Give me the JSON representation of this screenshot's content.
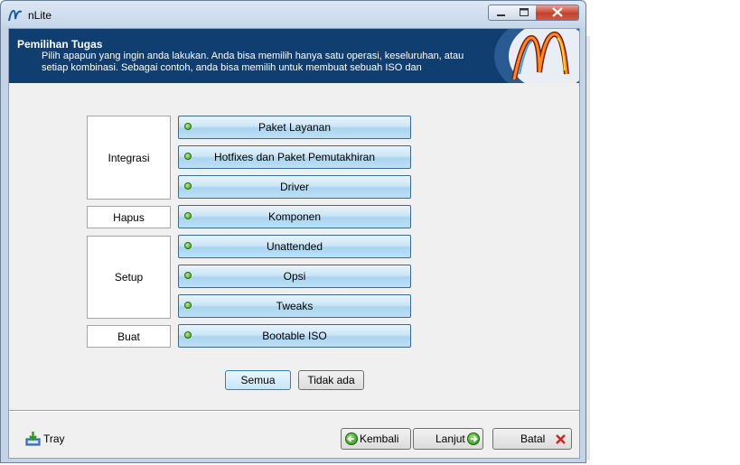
{
  "window": {
    "title": "nLite"
  },
  "header": {
    "title": "Pemilihan Tugas",
    "description": "Pilih apapun yang ingin anda lakukan. Anda bisa memilih hanya satu operasi, keseluruhan, atau setiap kombinasi. Sebagai contoh, anda bisa memilih untuk membuat sebuah ISO dan"
  },
  "groups": {
    "integrasi": "Integrasi",
    "hapus": "Hapus",
    "setup": "Setup",
    "buat": "Buat"
  },
  "tasks": [
    {
      "label": "Paket Layanan"
    },
    {
      "label": "Hotfixes dan Paket Pemutakhiran"
    },
    {
      "label": "Driver"
    },
    {
      "label": "Komponen"
    },
    {
      "label": "Unattended"
    },
    {
      "label": "Opsi"
    },
    {
      "label": "Tweaks"
    },
    {
      "label": "Bootable ISO"
    }
  ],
  "selection": {
    "all_label": "Semua",
    "none_label": "Tidak ada"
  },
  "footer": {
    "tray_label": "Tray",
    "back_label": "Kembali",
    "next_label": "Lanjut",
    "cancel_label": "Batal"
  },
  "colors": {
    "header_bg": "#113e71",
    "task_button": "#bfe0f4",
    "status_dot": "#3a9a1c",
    "cancel_icon": "#d02020"
  }
}
